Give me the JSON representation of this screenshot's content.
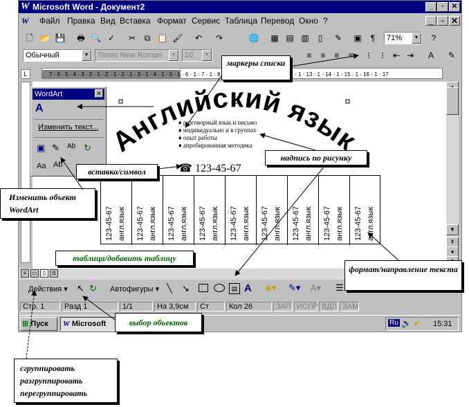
{
  "window": {
    "title": "Microsoft Word - Документ2",
    "controls": [
      "_",
      "▫",
      "✕"
    ]
  },
  "menu": [
    "Файл",
    "Правка",
    "Вид",
    "Вставка",
    "Формат",
    "Сервис",
    "Таблица",
    "Перевод",
    "Окно",
    "?"
  ],
  "formatting": {
    "style": "Обычный",
    "font": "Times New Roman",
    "size": "10",
    "zoom": "71%"
  },
  "wordart_panel": {
    "title": "WordArt",
    "edit_text": "Изменить текст..."
  },
  "document": {
    "wordart_text": "Английский язык",
    "bullets": [
      "разговорный язык и письмо",
      "индивидуально и в группах",
      "опыт работы",
      "апробированная методика"
    ],
    "phone": "123-45-67",
    "table": {
      "cols": 9,
      "phone": "123-45-67",
      "label": "англ.язык"
    }
  },
  "callouts": {
    "markers": "маркеры списка",
    "insert_symbol": "вставка/символ",
    "caption_picture": "надпись по рисунку",
    "edit_wordart": "Изменить объект WordArt",
    "table_add": "таблица/добавить таблицу",
    "format_direction": "формат/направление текста",
    "select_objects": "выбор объектов",
    "group": [
      "сгруппировать",
      "разгруппировать",
      "перегруппировать"
    ]
  },
  "drawing": {
    "actions": "Действия",
    "autoshapes": "Автофигуры"
  },
  "status": {
    "page": "Стр. 1",
    "section": "Разд 1",
    "pages": "1/1",
    "position": "На 3,9см",
    "line": "Ст",
    "col": "Кол 26",
    "rec": "ЗАП",
    "trk": "ИСПР",
    "ext": "ВДЛ",
    "ovr": "ЗАМ"
  },
  "taskbar": {
    "start": "Пуск",
    "task": "Microsoft",
    "lang": "Ru",
    "clock": "15:31"
  }
}
